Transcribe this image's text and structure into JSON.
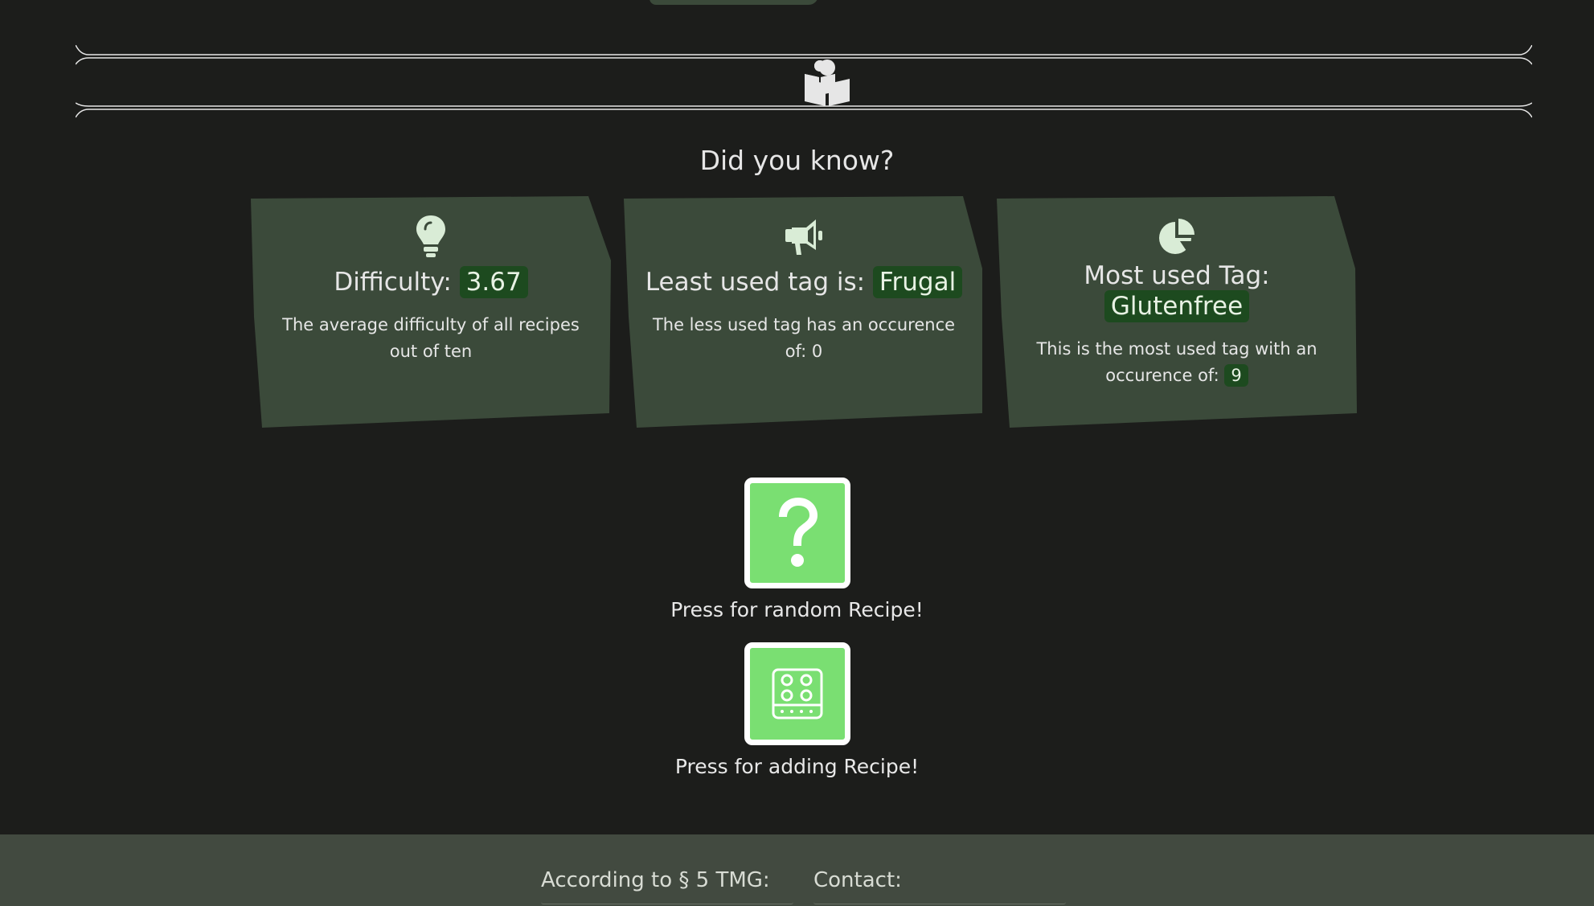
{
  "divider": {
    "icon": "reading-people-icon"
  },
  "did_you_know": {
    "title": "Did you know?",
    "cards": [
      {
        "icon": "lightbulb-icon",
        "heading_prefix": "Difficulty:",
        "heading_value": "3.67",
        "description": "The average difficulty of all recipes out of ten"
      },
      {
        "icon": "megaphone-icon",
        "heading_prefix": "Least used tag is:",
        "heading_value": "Frugal",
        "description": "The less used tag has an occurence of: 0"
      },
      {
        "icon": "pie-chart-icon",
        "heading_prefix": "Most used Tag:",
        "heading_value": "Glutenfree",
        "description_prefix": "This is the most used tag with an occurence of:",
        "description_value": "9"
      }
    ]
  },
  "actions": {
    "random": {
      "icon": "question-mark-icon",
      "label": "Press for random Recipe!"
    },
    "add": {
      "icon": "stove-icon",
      "label": "Press for adding Recipe!"
    }
  },
  "footer": {
    "imprint_heading": "According to § 5 TMG:",
    "contact_heading": "Contact:"
  },
  "colors": {
    "background": "#1c1d1b",
    "card": "#3b4a3a",
    "pill": "#1d4a1f",
    "button": "#7adf72",
    "footer": "#424a40"
  }
}
